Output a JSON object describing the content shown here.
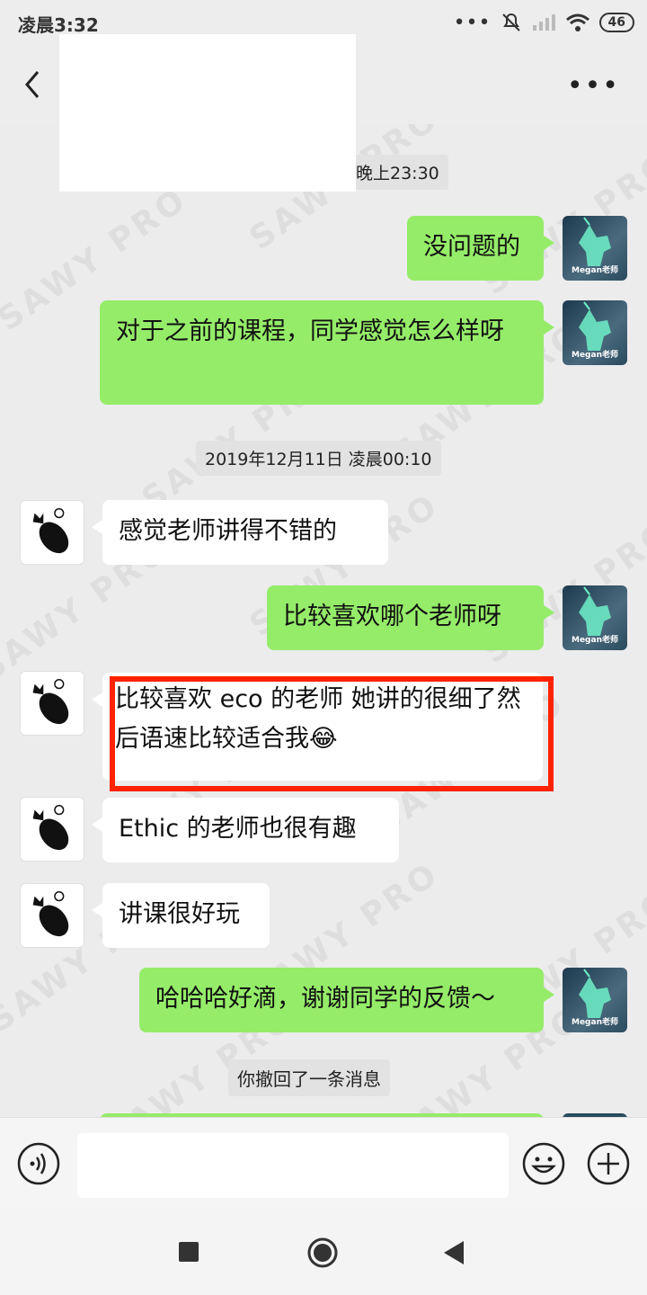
{
  "status_bar": {
    "time": "凌晨3:32",
    "battery": "46"
  },
  "header": {
    "title": ""
  },
  "messages": [
    {
      "id": "ts1",
      "type": "timestamp",
      "text": "晚上23:30"
    },
    {
      "id": "m1",
      "type": "outgoing",
      "text": "没问题的",
      "avatar_label": "Megan老师"
    },
    {
      "id": "m2",
      "type": "outgoing",
      "text": "对于之前的课程，同学感觉怎么样呀",
      "avatar_label": "Megan老师"
    },
    {
      "id": "ts2",
      "type": "timestamp",
      "text": "2019年12月11日 凌晨00:10"
    },
    {
      "id": "m3",
      "type": "incoming",
      "text": "感觉老师讲得不错的"
    },
    {
      "id": "m4",
      "type": "outgoing",
      "text": "比较喜欢哪个老师呀",
      "avatar_label": "Megan老师"
    },
    {
      "id": "m5",
      "type": "incoming",
      "text": "比较喜欢 eco 的老师 她讲的很细了然后语速比较适合我😂",
      "highlighted": true
    },
    {
      "id": "m6",
      "type": "incoming",
      "text": "Ethic 的老师也很有趣"
    },
    {
      "id": "m7",
      "type": "incoming",
      "text": "讲课很好玩"
    },
    {
      "id": "m8",
      "type": "outgoing",
      "text": "哈哈哈好滴，谢谢同学的反馈～",
      "avatar_label": "Megan老师"
    },
    {
      "id": "sys1",
      "type": "system",
      "text": "你撤回了一条消息"
    }
  ],
  "input": {
    "placeholder": ""
  },
  "watermark": "SAWY PRO",
  "colors": {
    "outgoing_bubble": "#95ec69",
    "incoming_bubble": "#ffffff",
    "highlight_border": "#ff2200",
    "background": "#ededed"
  },
  "icons": [
    "back-arrow-icon",
    "more-icon",
    "voice-icon",
    "emoji-icon",
    "plus-icon",
    "wifi-icon",
    "signal-icon",
    "mute-icon",
    "nav-square-icon",
    "nav-circle-icon",
    "nav-back-icon"
  ]
}
